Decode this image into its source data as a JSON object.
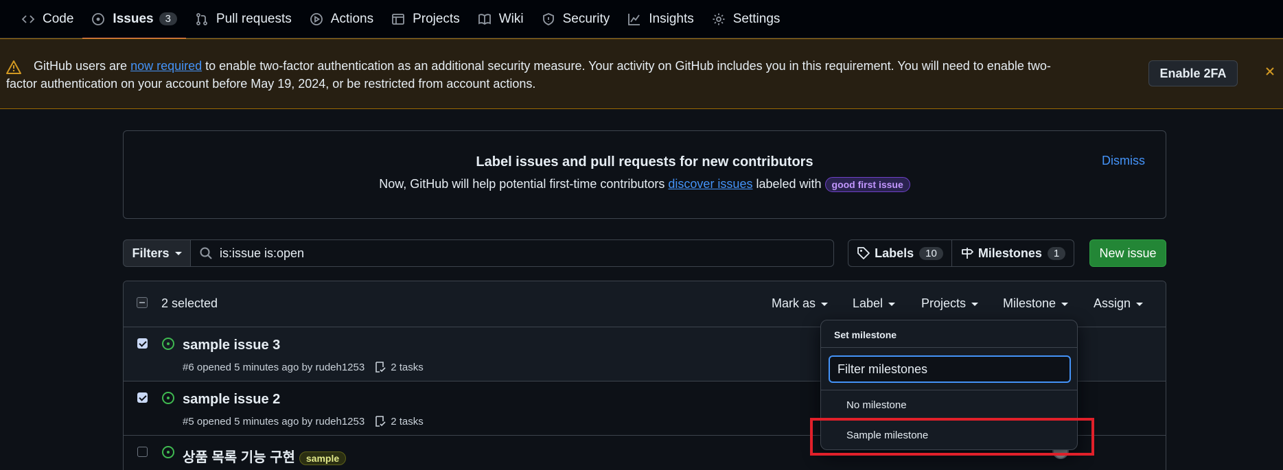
{
  "nav": {
    "tabs": [
      {
        "label": "Code"
      },
      {
        "label": "Issues",
        "count": "3"
      },
      {
        "label": "Pull requests"
      },
      {
        "label": "Actions"
      },
      {
        "label": "Projects"
      },
      {
        "label": "Wiki"
      },
      {
        "label": "Security"
      },
      {
        "label": "Insights"
      },
      {
        "label": "Settings"
      }
    ]
  },
  "banner": {
    "text_before": "GitHub users are ",
    "link": "now required",
    "text_after": " to enable two-factor authentication as an additional security measure. Your activity on GitHub includes you in this requirement. You will need to enable two-factor authentication on your account before May 19, 2024, or be restricted from account actions.",
    "button": "Enable 2FA"
  },
  "contributors": {
    "title": "Label issues and pull requests for new contributors",
    "sub_before": "Now, GitHub will help potential first-time contributors ",
    "sub_link": "discover issues",
    "sub_after": " labeled with ",
    "label": "good first issue",
    "dismiss": "Dismiss"
  },
  "toolbar": {
    "filters": "Filters",
    "query": "is:issue is:open",
    "labels": "Labels",
    "labels_count": "10",
    "milestones": "Milestones",
    "milestones_count": "1",
    "new_issue": "New issue"
  },
  "table": {
    "selected": "2 selected",
    "menus": [
      "Mark as",
      "Label",
      "Projects",
      "Milestone",
      "Assign"
    ],
    "rows": [
      {
        "title": "sample issue 3",
        "meta": "#6 opened 5 minutes ago by rudeh1253",
        "tasks": "2 tasks"
      },
      {
        "title": "sample issue 2",
        "meta": "#5 opened 5 minutes ago by rudeh1253",
        "tasks": "2 tasks"
      },
      {
        "title": "상품 목록 기능 구현",
        "label": "sample"
      }
    ]
  },
  "dropdown": {
    "header": "Set milestone",
    "placeholder": "Filter milestones",
    "items": [
      "No milestone",
      "Sample milestone"
    ]
  },
  "colors": {
    "background": "#0d1117",
    "accent": "#4493f8",
    "open_green": "#3fb950",
    "highlight_red": "#e0202a"
  }
}
